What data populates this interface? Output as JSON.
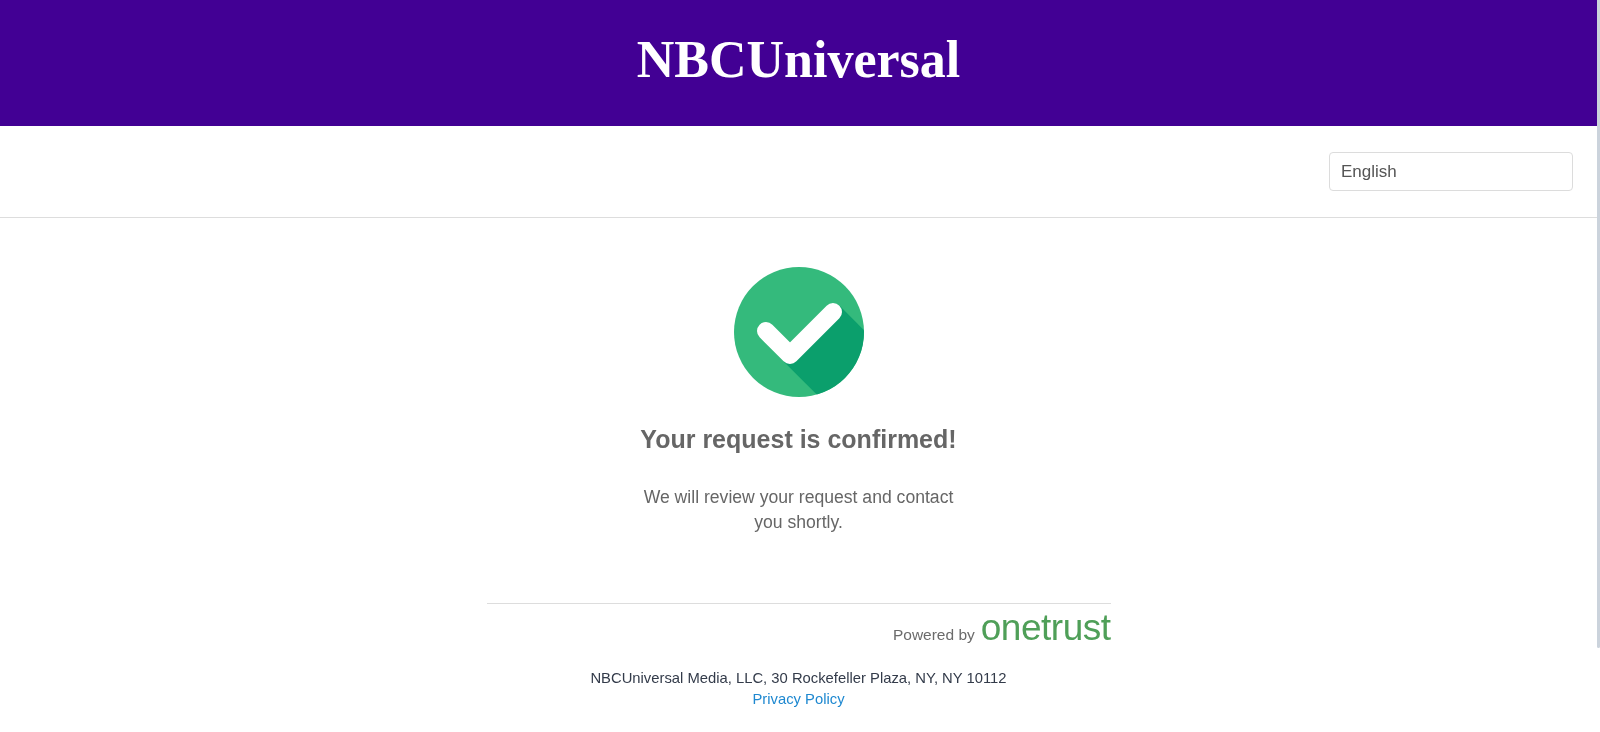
{
  "header": {
    "logo": "NBCUniversal"
  },
  "language_select": {
    "value": "English"
  },
  "confirmation": {
    "title": "Your request is confirmed!",
    "message": "We will review your request and contact you shortly."
  },
  "powered_by": {
    "label": "Powered by",
    "logo": "onetrust"
  },
  "footer": {
    "address": "NBCUniversal Media, LLC, 30 Rockefeller Plaza, NY, NY 10112",
    "link": "Privacy Policy"
  }
}
